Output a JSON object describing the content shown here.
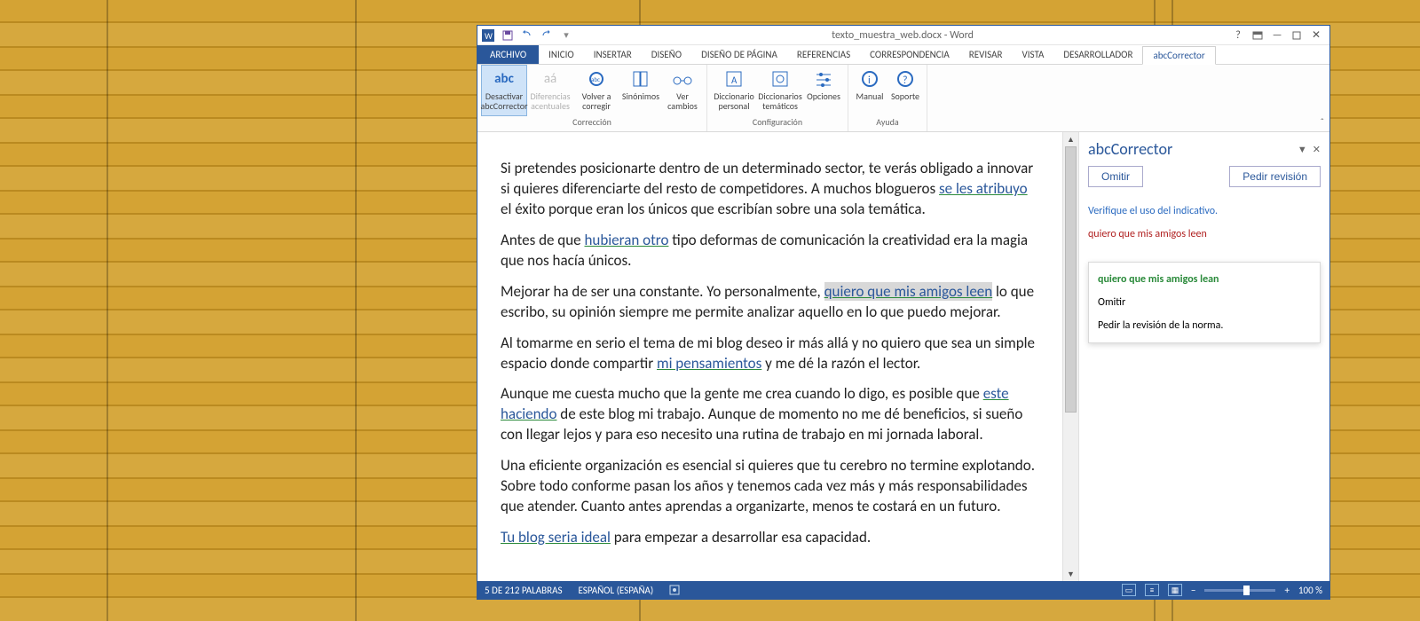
{
  "title_center": "texto_muestra_web.docx - Word",
  "menu": {
    "file": "ARCHIVO",
    "tabs": [
      "INICIO",
      "INSERTAR",
      "DISEÑO",
      "DISEÑO DE PÁGINA",
      "REFERENCIAS",
      "CORRESPONDENCIA",
      "REVISAR",
      "VISTA",
      "DESARROLLADOR"
    ],
    "active": "abcCorrector"
  },
  "ribbon": {
    "group_correccion": {
      "label": "Corrección",
      "btns": [
        {
          "l1": "Desactivar",
          "l2": "abcCorrector",
          "icon": "abc",
          "selected": true
        },
        {
          "l1": "Diferencias",
          "l2": "acentuales",
          "icon": "aa",
          "disabled": true
        },
        {
          "l1": "Volver a",
          "l2": "corregir",
          "icon": "refresh"
        },
        {
          "l1": "Sinónimos",
          "l2": "",
          "icon": "book"
        },
        {
          "l1": "Ver",
          "l2": "cambios",
          "icon": "glasses"
        }
      ]
    },
    "group_config": {
      "label": "Configuración",
      "btns": [
        {
          "l1": "Diccionario",
          "l2": "personal",
          "icon": "dictA"
        },
        {
          "l1": "Diccionarios",
          "l2": "temáticos",
          "icon": "dictB"
        },
        {
          "l1": "Opciones",
          "l2": "",
          "icon": "sliders"
        }
      ]
    },
    "group_ayuda": {
      "label": "Ayuda",
      "btns": [
        {
          "l1": "Manual",
          "l2": "",
          "icon": "info"
        },
        {
          "l1": "Soporte",
          "l2": "",
          "icon": "help"
        }
      ]
    }
  },
  "doc": {
    "p1a": "Si pretendes posicionarte dentro de un determinado sector, te verás obligado a innovar si quieres diferenciarte del resto de competidores.  A muchos blogueros ",
    "p1m": "se les atribuyo",
    "p1b": " el éxito porque eran los únicos que escribían sobre una sola temática.",
    "p2a": " Antes de que ",
    "p2m": "hubieran otro",
    "p2b": " tipo deformas de comunicación la creatividad era la magia que nos hacía únicos.",
    "p3a": "Mejorar ha de ser una constante. Yo personalmente,  ",
    "p3m": "quiero que mis amigos leen",
    "p3b": " lo que escribo, su opinión siempre me permite analizar aquello en lo que puedo mejorar.",
    "p4a": "Al tomarme en serio el tema de mi blog  deseo ir más allá y no quiero que sea un simple espacio donde compartir ",
    "p4m": "mi pensamientos",
    "p4b": " y me dé la razón el lector.",
    "p5a": "Aunque me cuesta mucho que la gente me crea cuando lo digo,  es posible que ",
    "p5m": "este haciendo",
    "p5b": " de este blog  mi trabajo. Aunque de momento no me dé beneficios, si sueño con llegar lejos y para eso necesito una rutina de trabajo en mi jornada laboral.",
    "p6": "Una eficiente organización es esencial si quieres que tu cerebro no termine explotando. Sobre todo conforme pasan los años y tenemos cada vez más y más responsabilidades que atender. Cuanto antes aprendas a organizarte, menos te costará en un futuro.",
    "p7m": "Tu blog seria ideal",
    "p7b": " para empezar a desarrollar esa capacidad."
  },
  "pane": {
    "title": "abcCorrector",
    "omit": "Omitir",
    "request": "Pedir revisión",
    "hint": "Verifique el uso del indicativo.",
    "orig": "quiero que mis amigos leen",
    "menu": {
      "sugg": "quiero que mis amigos lean",
      "omit": "Omitir",
      "req": "Pedir la revisión de la norma."
    }
  },
  "status": {
    "words": "5 DE 212 PALABRAS",
    "lang": "ESPAÑOL (ESPAÑA)",
    "zoom": "100 %"
  }
}
